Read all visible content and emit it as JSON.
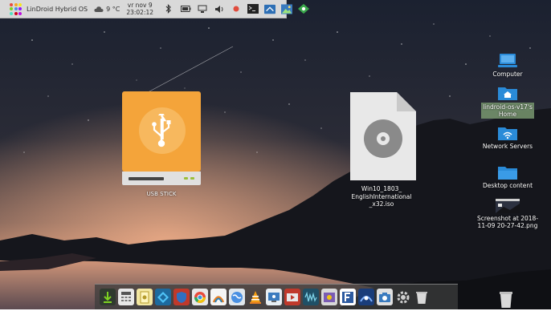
{
  "panel": {
    "os_name": "LinDroid Hybrid OS",
    "temperature": "9 °C",
    "date": "vr nov 9",
    "time": "23:02:12",
    "tray_icons": [
      "bluetooth-icon",
      "battery-icon",
      "network-icon",
      "volume-icon",
      "record-icon",
      "terminal-icon",
      "screen-icon",
      "image-viewer-icon",
      "network-manager-icon"
    ]
  },
  "desktop": {
    "usb_label": "USB STICK",
    "iso_label_line1": "Win10_1803_",
    "iso_label_line2": "EnglishInternational",
    "iso_label_line3": "_x32.iso",
    "icons": [
      {
        "name": "computer",
        "label": "Computer"
      },
      {
        "name": "home",
        "label_line1": "lindroid-os-v17's",
        "label_line2": "Home"
      },
      {
        "name": "network",
        "label": "Network Servers"
      },
      {
        "name": "desktop",
        "label": "Desktop content"
      },
      {
        "name": "screenshot",
        "label_line1": "Screenshot at 2018-",
        "label_line2": "11-09 20-27-42.png"
      }
    ]
  },
  "dock": {
    "apps": [
      "android-icon",
      "calculator-icon",
      "notes-icon",
      "kodi-icon",
      "security-icon",
      "chrome-icon",
      "tuxpaint-icon",
      "globe-icon",
      "vlc-icon",
      "screenshot-icon",
      "video-icon",
      "waves-icon",
      "image-editor-icon",
      "font-icon",
      "shutter-icon",
      "camera-icon",
      "settings-icon",
      "trash-icon"
    ]
  },
  "colors": {
    "usb_orange": "#f4a43a",
    "folder_blue": "#2a8bd8",
    "panel_bg": "#d9d9d9"
  }
}
